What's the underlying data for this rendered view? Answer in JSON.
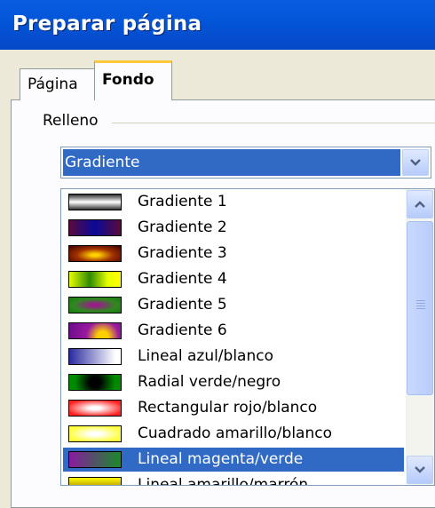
{
  "window": {
    "title": "Preparar página"
  },
  "tabs": [
    {
      "label": "Página",
      "active": false
    },
    {
      "label": "Fondo",
      "active": true
    }
  ],
  "group": {
    "label": "Relleno"
  },
  "fill_type": {
    "selected": "Gradiente",
    "icon": "chevron-down-icon"
  },
  "gradient_list": {
    "items": [
      {
        "label": "Gradiente 1"
      },
      {
        "label": "Gradiente 2"
      },
      {
        "label": "Gradiente 3"
      },
      {
        "label": "Gradiente 4"
      },
      {
        "label": "Gradiente 5"
      },
      {
        "label": "Gradiente 6"
      },
      {
        "label": "Lineal azul/blanco"
      },
      {
        "label": "Radial verde/negro"
      },
      {
        "label": "Rectangular rojo/blanco"
      },
      {
        "label": "Cuadrado amarillo/blanco"
      },
      {
        "label": "Lineal magenta/verde",
        "selected": true
      },
      {
        "label": "Lineal amarillo/marrón"
      }
    ]
  },
  "colors": {
    "accent": "#316ac5",
    "title_bar": "#0356d8",
    "active_tab_border": "#ffc83c"
  }
}
